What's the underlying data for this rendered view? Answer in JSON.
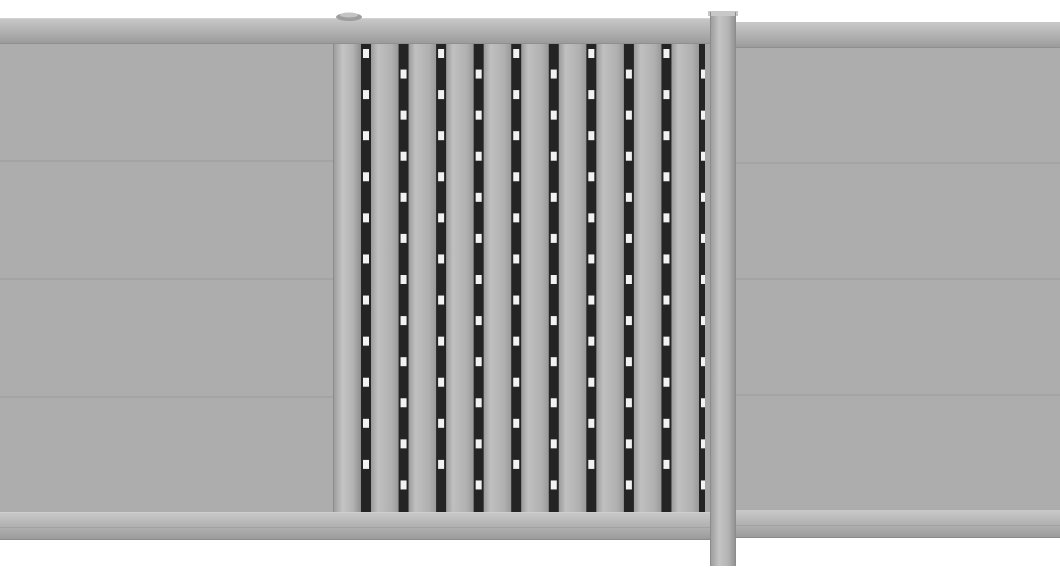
{
  "image": {
    "subject": "sliding-gate",
    "background_color": "#ffffff"
  },
  "colors": {
    "panel": "#adadad",
    "panel_light": "#b8b8b8",
    "frame": "#b3b3b3",
    "frame_highlight": "#c6c6c6",
    "frame_shadow": "#8f8f8f",
    "seam": "#9c9c9c",
    "gap_dark": "#242424",
    "slat": "#b0b0b0",
    "slat_highlight": "#c2c2c2",
    "slat_shadow": "#979797",
    "light_gap": "#f2f2f2"
  },
  "gate": {
    "left_panel_boards": 4,
    "right_panel_boards": 4,
    "vertical_slats": 9,
    "light_slots_per_gap": 11
  }
}
